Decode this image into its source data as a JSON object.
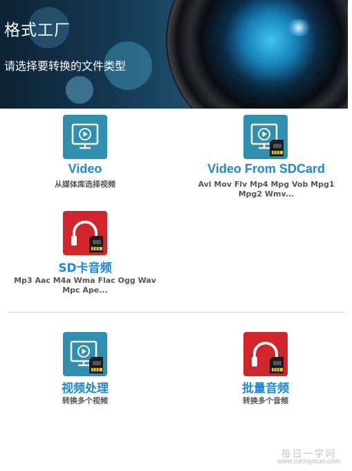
{
  "header": {
    "title": "格式工厂",
    "subtitle": "请选择要转换的文件类型"
  },
  "items": [
    {
      "label": "Video",
      "desc": "从媒体库选择视频",
      "icon": "monitor-play-icon",
      "color": "#2f8fae"
    },
    {
      "label": "Video From SDCard",
      "desc": "Avi Mov Flv Mp4 Mpg Vob Mpg1 Mpg2 Wmv...",
      "icon": "monitor-sdcard-icon",
      "color": "#2f8fae"
    },
    {
      "label": "SD卡音频",
      "desc": "Mp3 Aac M4a Wma Flac Ogg Wav Mpc Ape...",
      "icon": "headphones-sdcard-icon",
      "color": "#d1252b"
    },
    {
      "label": "视频处理",
      "desc": "转换多个视频",
      "icon": "monitor-sdcard-icon",
      "color": "#2f8fae"
    },
    {
      "label": "批量音频",
      "desc": "转换多个音频",
      "icon": "headphones-sdcard-icon",
      "color": "#d1252b"
    }
  ],
  "watermark": {
    "top": "每日一学网",
    "bottom": "www.meiriyixue.com"
  },
  "colors": {
    "accent": "#1d87d8",
    "video_tile": "#2f8fae",
    "audio_tile": "#d1252b"
  }
}
